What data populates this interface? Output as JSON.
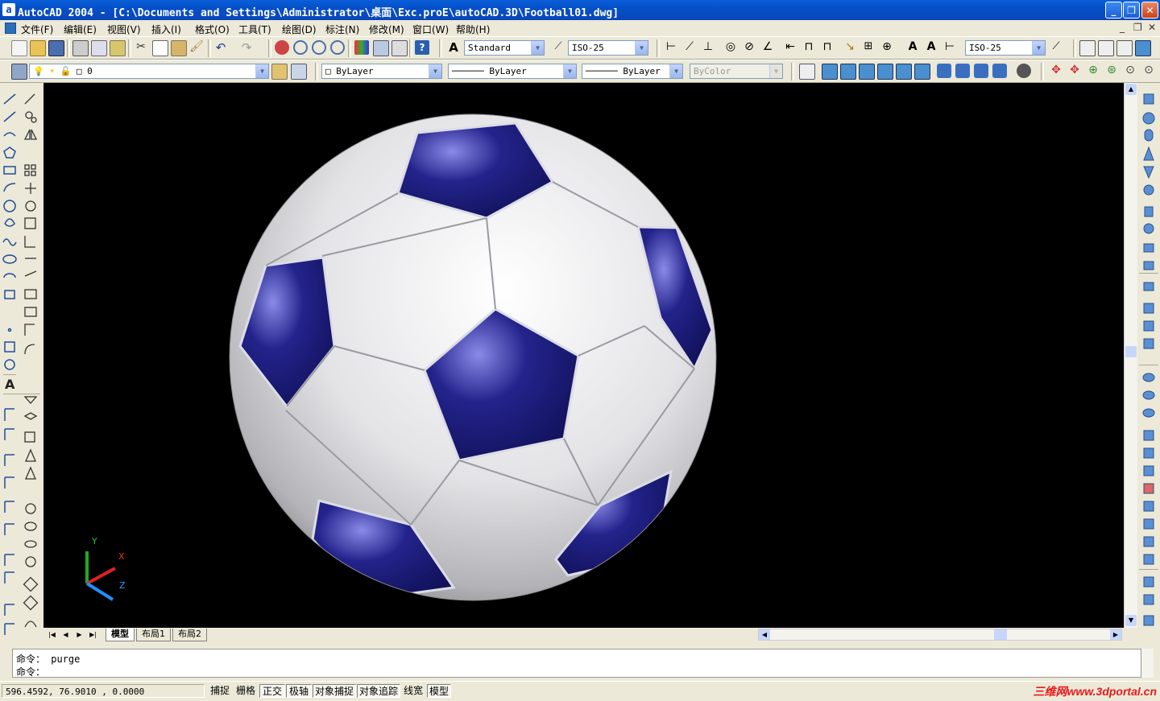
{
  "window": {
    "app_icon": "a",
    "title": "AutoCAD 2004 - [C:\\Documents and Settings\\Administrator\\桌面\\Exc.proE\\autoCAD.3D\\Football01.dwg]",
    "minimize": "_",
    "restore": "❐",
    "close": "✕"
  },
  "menu": {
    "items": [
      "文件(F)",
      "编辑(E)",
      "视图(V)",
      "插入(I)",
      "格式(O)",
      "工具(T)",
      "绘图(D)",
      "标注(N)",
      "修改(M)",
      "窗口(W)",
      "帮助(H)"
    ],
    "mdi_min": "_",
    "mdi_restore": "❐",
    "mdi_close": "✕"
  },
  "toolbar1": {
    "text_style": "Standard",
    "dim_style": "ISO-25",
    "dim_style2": "ISO-25"
  },
  "toolbar2": {
    "layer": "0",
    "color": "ByLayer",
    "linetype": "ByLayer",
    "lineweight": "ByLayer",
    "plot_style": "ByColor"
  },
  "canvas": {
    "background": "#000000",
    "ucs": {
      "x_label": "X",
      "y_label": "Y",
      "z_label": "Z"
    },
    "ball": {
      "panel_color": "#ffffff",
      "pentagon_color": "#1a1a7a"
    }
  },
  "tabs": {
    "items": [
      "模型",
      "布局1",
      "布局2"
    ],
    "active": "模型"
  },
  "command": {
    "history": "命令： purge",
    "prompt": "命令："
  },
  "status": {
    "coordinates": "596.4592,   76.9010 , 0.0000",
    "toggles": [
      {
        "label": "捕捉",
        "on": false
      },
      {
        "label": "栅格",
        "on": false
      },
      {
        "label": "正交",
        "on": true
      },
      {
        "label": "极轴",
        "on": true
      },
      {
        "label": "对象捕捉",
        "on": true
      },
      {
        "label": "对象追踪",
        "on": true
      },
      {
        "label": "线宽",
        "on": false
      },
      {
        "label": "模型",
        "on": true
      }
    ],
    "watermark": "三维网www.3dportal.cn"
  }
}
